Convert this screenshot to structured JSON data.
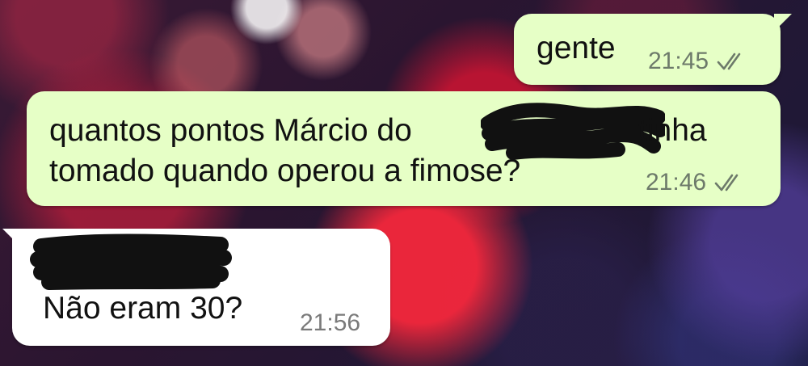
{
  "messages": [
    {
      "direction": "outgoing",
      "text": "gente",
      "time": "21:45",
      "status_icon": "double-check-icon"
    },
    {
      "direction": "outgoing",
      "line1_before_redaction": "quantos pontos Márcio do",
      "line1_after_redaction": "tinha",
      "line2": "tomado quando operou a fimose?",
      "time": "21:46",
      "status_icon": "double-check-icon"
    },
    {
      "direction": "incoming",
      "sender_redacted": true,
      "text": "Não eram 30?",
      "time": "21:56"
    }
  ],
  "colors": {
    "outgoing_bubble": "#e6ffc6",
    "incoming_bubble": "#ffffff",
    "redaction": "#111111"
  }
}
